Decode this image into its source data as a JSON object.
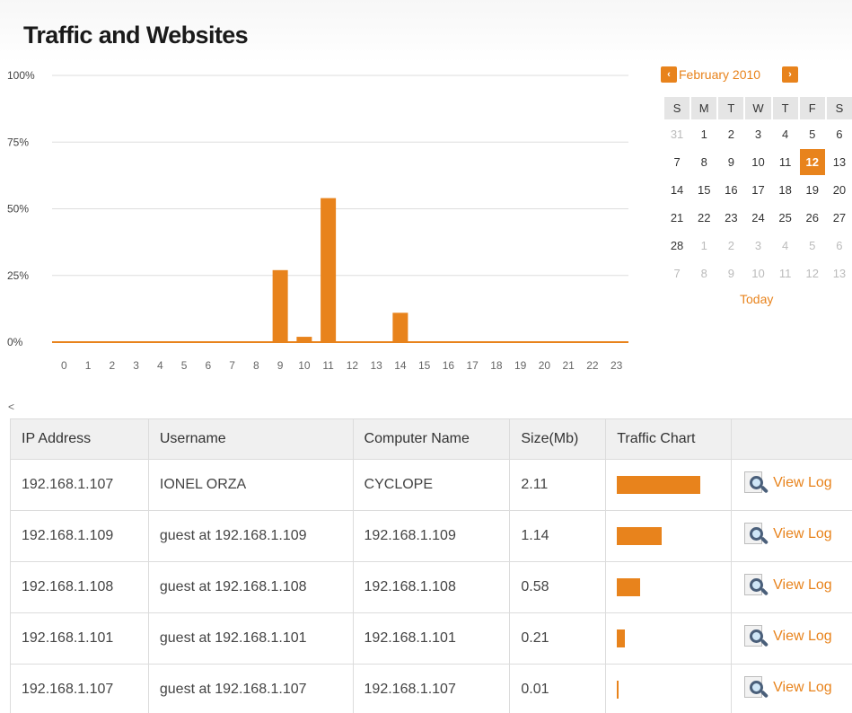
{
  "page": {
    "title": "Traffic and Websites"
  },
  "chart_data": {
    "type": "bar",
    "categories": [
      "0",
      "1",
      "2",
      "3",
      "4",
      "5",
      "6",
      "7",
      "8",
      "9",
      "10",
      "11",
      "12",
      "13",
      "14",
      "15",
      "16",
      "17",
      "18",
      "19",
      "20",
      "21",
      "22",
      "23"
    ],
    "values": [
      0,
      0,
      0,
      0,
      0,
      0,
      0,
      0,
      0,
      27,
      2,
      54,
      0,
      0,
      11,
      0,
      0,
      0,
      0,
      0,
      0,
      0,
      0,
      0
    ],
    "y_ticks": [
      "100%",
      "75%",
      "50%",
      "25%",
      "0%"
    ],
    "ylim": [
      0,
      100
    ],
    "color": "#e8831c",
    "grid": true
  },
  "calendar": {
    "month_label": "February 2010",
    "prev_icon": "chevron-left-icon",
    "next_icon": "chevron-right-icon",
    "weekdays": [
      "S",
      "M",
      "T",
      "W",
      "T",
      "F",
      "S"
    ],
    "weeks": [
      [
        {
          "d": "31",
          "o": true
        },
        {
          "d": "1"
        },
        {
          "d": "2"
        },
        {
          "d": "3"
        },
        {
          "d": "4"
        },
        {
          "d": "5"
        },
        {
          "d": "6"
        }
      ],
      [
        {
          "d": "7"
        },
        {
          "d": "8"
        },
        {
          "d": "9"
        },
        {
          "d": "10"
        },
        {
          "d": "11"
        },
        {
          "d": "12",
          "sel": true
        },
        {
          "d": "13"
        }
      ],
      [
        {
          "d": "14"
        },
        {
          "d": "15"
        },
        {
          "d": "16"
        },
        {
          "d": "17"
        },
        {
          "d": "18"
        },
        {
          "d": "19"
        },
        {
          "d": "20"
        }
      ],
      [
        {
          "d": "21"
        },
        {
          "d": "22"
        },
        {
          "d": "23"
        },
        {
          "d": "24"
        },
        {
          "d": "25"
        },
        {
          "d": "26"
        },
        {
          "d": "27"
        }
      ],
      [
        {
          "d": "28"
        },
        {
          "d": "1",
          "o": true
        },
        {
          "d": "2",
          "o": true
        },
        {
          "d": "3",
          "o": true
        },
        {
          "d": "4",
          "o": true
        },
        {
          "d": "5",
          "o": true
        },
        {
          "d": "6",
          "o": true
        }
      ],
      [
        {
          "d": "7",
          "o": true
        },
        {
          "d": "8",
          "o": true
        },
        {
          "d": "9",
          "o": true
        },
        {
          "d": "10",
          "o": true
        },
        {
          "d": "11",
          "o": true
        },
        {
          "d": "12",
          "o": true
        },
        {
          "d": "13",
          "o": true
        }
      ]
    ],
    "today_label": "Today"
  },
  "collapse_label": "<",
  "table": {
    "headers": [
      "IP Address",
      "Username",
      "Computer Name",
      "Size(Mb)",
      "Traffic Chart",
      ""
    ],
    "max_size": 2.11,
    "rows": [
      {
        "ip": "192.168.1.107",
        "user": "IONEL ORZA",
        "computer": "CYCLOPE",
        "size": "2.11",
        "size_value": 2.11,
        "action": "View Log"
      },
      {
        "ip": "192.168.1.109",
        "user": "guest at 192.168.1.109",
        "computer": "192.168.1.109",
        "size": "1.14",
        "size_value": 1.14,
        "action": "View Log"
      },
      {
        "ip": "192.168.1.108",
        "user": "guest at 192.168.1.108",
        "computer": "192.168.1.108",
        "size": "0.58",
        "size_value": 0.58,
        "action": "View Log"
      },
      {
        "ip": "192.168.1.101",
        "user": "guest at 192.168.1.101",
        "computer": "192.168.1.101",
        "size": "0.21",
        "size_value": 0.21,
        "action": "View Log"
      },
      {
        "ip": "192.168.1.107",
        "user": "guest at 192.168.1.107",
        "computer": "192.168.1.107",
        "size": "0.01",
        "size_value": 0.01,
        "action": "View Log"
      }
    ],
    "action_icon": "view-log-magnifier-icon"
  }
}
